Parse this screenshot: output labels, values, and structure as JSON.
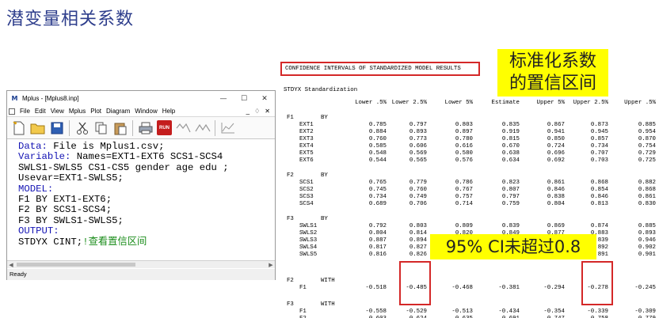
{
  "slide": {
    "title": "潜变量相关系数"
  },
  "window": {
    "title": "Mplus - [Mplus8.inp]",
    "icon_letter": "M",
    "controls": {
      "minimize": "—",
      "maximize": "☐",
      "close": "✕"
    },
    "menu": [
      "File",
      "Edit",
      "View",
      "Mplus",
      "Plot",
      "Diagram",
      "Window",
      "Help"
    ],
    "mdi_controls": [
      "_",
      "♢",
      "✕"
    ],
    "run_label": "RUN",
    "status": "Ready"
  },
  "editor": {
    "lines": [
      {
        "kw": "Data:",
        "rest": " File is Mplus1.csv;"
      },
      {
        "kw": "Variable:",
        "rest": " Names=EXT1-EXT6 SCS1-SCS4"
      },
      {
        "kw": "",
        "rest": "SWLS1-SWLS5 CS1-CS5 gender age edu ;"
      },
      {
        "kw": "",
        "rest": "Usevar=EXT1-SWLS5;"
      },
      {
        "kw": "MODEL:",
        "rest": ""
      },
      {
        "kw": "",
        "rest": "F1 BY EXT1-EXT6;"
      },
      {
        "kw": "",
        "rest": "F2 BY SCS1-SCS4;"
      },
      {
        "kw": "",
        "rest": "F3 BY SWLS1-SWLS5;"
      },
      {
        "kw": "OUTPUT:",
        "rest": ""
      },
      {
        "kw": "",
        "rest": "STDYX CINT;",
        "comment": "!查看置信区间"
      }
    ]
  },
  "output": {
    "heading": "CONFIDENCE INTERVALS OF STANDARDIZED MODEL RESULTS",
    "subheading": "STDYX Standardization",
    "columns": [
      "Lower .5%",
      "Lower 2.5%",
      "Lower 5%",
      "Estimate",
      "Upper 5%",
      "Upper 2.5%",
      "Upper .5%"
    ],
    "blocks": [
      {
        "factor": "F1",
        "rel": "BY",
        "rows": [
          {
            "v": "EXT1",
            "vals": [
              "0.785",
              "0.797",
              "0.803",
              "0.835",
              "0.867",
              "0.873",
              "0.885"
            ]
          },
          {
            "v": "EXT2",
            "vals": [
              "0.884",
              "0.893",
              "0.897",
              "0.919",
              "0.941",
              "0.945",
              "0.954"
            ]
          },
          {
            "v": "EXT3",
            "vals": [
              "0.760",
              "0.773",
              "0.780",
              "0.815",
              "0.850",
              "0.857",
              "0.870"
            ]
          },
          {
            "v": "EXT4",
            "vals": [
              "0.585",
              "0.606",
              "0.616",
              "0.670",
              "0.724",
              "0.734",
              "0.754"
            ]
          },
          {
            "v": "EXT5",
            "vals": [
              "0.548",
              "0.569",
              "0.580",
              "0.638",
              "0.696",
              "0.707",
              "0.729"
            ]
          },
          {
            "v": "EXT6",
            "vals": [
              "0.544",
              "0.565",
              "0.576",
              "0.634",
              "0.692",
              "0.703",
              "0.725"
            ]
          }
        ]
      },
      {
        "factor": "F2",
        "rel": "BY",
        "rows": [
          {
            "v": "SCS1",
            "vals": [
              "0.765",
              "0.779",
              "0.786",
              "0.823",
              "0.861",
              "0.868",
              "0.882"
            ]
          },
          {
            "v": "SCS2",
            "vals": [
              "0.745",
              "0.760",
              "0.767",
              "0.807",
              "0.846",
              "0.854",
              "0.868"
            ]
          },
          {
            "v": "SCS3",
            "vals": [
              "0.734",
              "0.749",
              "0.757",
              "0.797",
              "0.838",
              "0.846",
              "0.861"
            ]
          },
          {
            "v": "SCS4",
            "vals": [
              "0.689",
              "0.706",
              "0.714",
              "0.759",
              "0.804",
              "0.813",
              "0.830"
            ]
          }
        ]
      },
      {
        "factor": "F3",
        "rel": "BY",
        "rows": [
          {
            "v": "SWLS1",
            "vals": [
              "0.792",
              "0.803",
              "0.809",
              "0.839",
              "0.869",
              "0.874",
              "0.885"
            ]
          },
          {
            "v": "SWLS2",
            "vals": [
              "0.804",
              "0.814",
              "0.820",
              "0.849",
              "0.877",
              "0.883",
              "0.893"
            ]
          },
          {
            "v": "SWLS3",
            "vals": [
              "0.887",
              "0.894",
              "",
              "",
              "",
              "839",
              "0.946"
            ]
          },
          {
            "v": "SWLS4",
            "vals": [
              "0.817",
              "0.827",
              "",
              "",
              "",
              "892",
              "0.902"
            ]
          },
          {
            "v": "SWLS5",
            "vals": [
              "0.816",
              "0.826",
              "",
              "",
              "",
              "891",
              "0.901"
            ]
          }
        ]
      },
      {
        "factor": "F2",
        "rel": "WITH",
        "rows": [
          {
            "v": "F1",
            "vals": [
              "-0.518",
              "-0.485",
              "-0.468",
              "-0.381",
              "-0.294",
              "-0.278",
              "-0.245"
            ]
          }
        ]
      },
      {
        "factor": "F3",
        "rel": "WITH",
        "rows": [
          {
            "v": "F1",
            "vals": [
              "-0.558",
              "-0.529",
              "-0.513",
              "-0.434",
              "-0.354",
              "-0.339",
              "-0.309"
            ]
          },
          {
            "v": "F2",
            "vals": [
              "0.603",
              "0.624",
              "0.635",
              "0.691",
              "0.747",
              "0.758",
              "0.779"
            ]
          }
        ]
      }
    ]
  },
  "callouts": {
    "std_ci": "标准化系数\n的置信区间",
    "ci_note": "95% CI未超过0.8"
  },
  "colors": {
    "title": "#2e3e8c",
    "highlight": "#ffff00",
    "box": "#d42828",
    "keyword": "#1414b4",
    "comment": "#1a8c1a"
  }
}
